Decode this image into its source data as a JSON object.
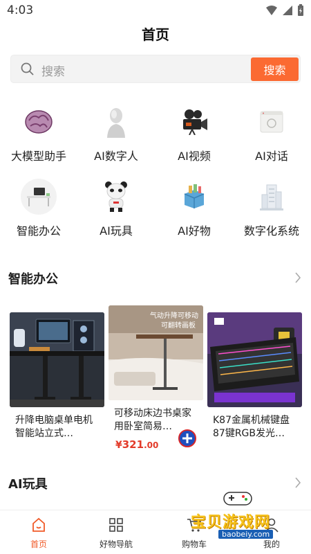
{
  "status_bar": {
    "time": "4:03"
  },
  "header": {
    "title": "首页"
  },
  "search": {
    "placeholder": "搜索",
    "button_label": "搜索"
  },
  "categories": [
    {
      "label": "大模型助手",
      "icon": "brain-icon"
    },
    {
      "label": "AI数字人",
      "icon": "digital-human-icon"
    },
    {
      "label": "AI视频",
      "icon": "video-camera-icon"
    },
    {
      "label": "AI对话",
      "icon": "chat-window-icon"
    },
    {
      "label": "智能办公",
      "icon": "office-desk-icon"
    },
    {
      "label": "AI玩具",
      "icon": "robot-toy-icon"
    },
    {
      "label": "AI好物",
      "icon": "gift-box-icon"
    },
    {
      "label": "数字化系统",
      "icon": "building-icon"
    }
  ],
  "sections": [
    {
      "title": "智能办公",
      "products": [
        {
          "title": "升降电脑桌单电机智能站立式…",
          "price": ""
        },
        {
          "title": "可移动床边书桌家用卧室简易…",
          "price_symbol": "¥",
          "price_integer": "321",
          "price_decimal": ".00",
          "image_caption_1": "气动升降可移动",
          "image_caption_2": "可翻转画板"
        },
        {
          "title": "K87金属机械键盘87键RGB发光…",
          "price": ""
        }
      ]
    },
    {
      "title": "AI玩具"
    }
  ],
  "tab_bar": {
    "items": [
      {
        "label": "首页",
        "icon": "home-icon",
        "active": true
      },
      {
        "label": "好物导航",
        "icon": "grid-icon",
        "active": false
      },
      {
        "label": "购物车",
        "icon": "cart-icon",
        "active": false
      },
      {
        "label": "我的",
        "icon": "user-icon",
        "active": false
      }
    ]
  },
  "watermark": {
    "text": "宝贝游戏网",
    "url": "baobeiy.com"
  },
  "colors": {
    "accent": "#fb6a32",
    "price": "#e33b2a",
    "active_tab": "#f05a28"
  }
}
